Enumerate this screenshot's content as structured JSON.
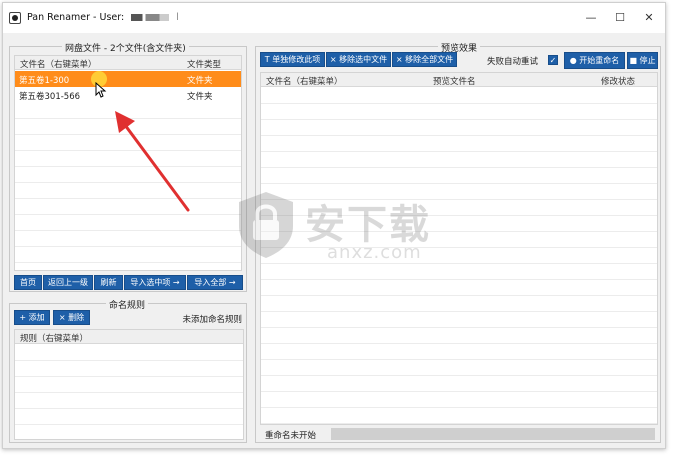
{
  "window": {
    "title": "Pan Renamer - User:",
    "user_suffix": "l",
    "controls": {
      "minimize": "—",
      "maximize": "☐",
      "close": "✕"
    }
  },
  "netdisk_panel": {
    "legend": "网盘文件 - 2个文件(含文件夹)",
    "columns": [
      "文件名（右键菜单）",
      "文件类型"
    ],
    "rows": [
      {
        "name": "第五卷1-300",
        "type": "文件夹",
        "selected": true
      },
      {
        "name": "第五卷301-566",
        "type": "文件夹",
        "selected": false
      }
    ],
    "buttons": [
      "首页",
      "返回上一级",
      "刷新",
      "导入选中项 →",
      "导入全部 →"
    ]
  },
  "rules_panel": {
    "legend": "命名规则",
    "add_button": "+ 添加",
    "delete_button": "× 删除",
    "status": "未添加命名规则",
    "column": "规则（右键菜单）"
  },
  "preview_panel": {
    "legend": "预览效果",
    "buttons": [
      "T 单独修改此项",
      "× 移除选中文件",
      "× 移除全部文件"
    ],
    "retry_label": "失败自动重试",
    "retry_checked": true,
    "start_button": "● 开始重命名",
    "stop_button": "■ 停止",
    "columns": [
      "文件名（右键菜单）",
      "预览文件名",
      "修改状态"
    ],
    "status_text": "重命名未开始"
  },
  "watermark": {
    "text": "安下载",
    "sub": "anxz.com"
  },
  "colors": {
    "accent_blue": "#1e5fa8",
    "selection_orange": "#ff8c1a",
    "arrow_red": "#e03030"
  }
}
